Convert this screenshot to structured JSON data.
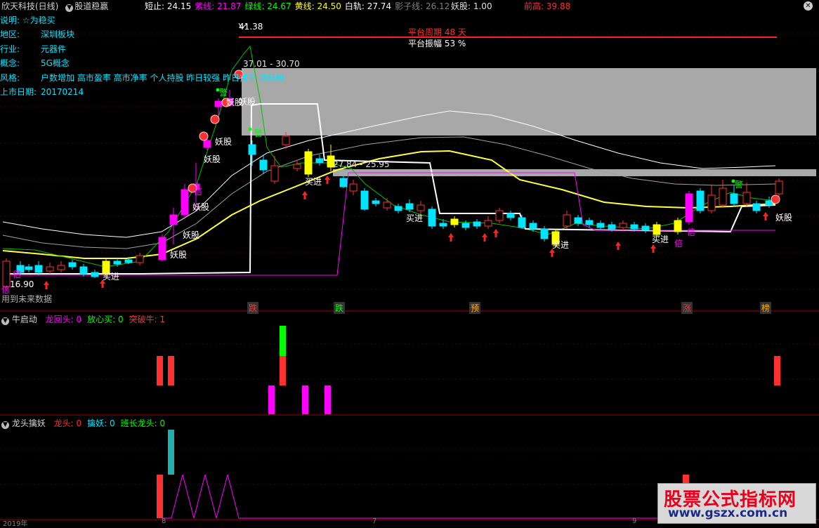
{
  "header": {
    "stock": "欣天科技(日线)",
    "indicator": "股道稳赢",
    "items": [
      {
        "label": "短止:",
        "value": "24.15",
        "color": "#ffffff"
      },
      {
        "label": "紫线:",
        "value": "21.87",
        "color": "#ff00ff"
      },
      {
        "label": "绿线:",
        "value": "24.67",
        "color": "#00ff00"
      },
      {
        "label": "黄线:",
        "value": "24.50",
        "color": "#ffff00"
      },
      {
        "label": "白轨:",
        "value": "27.74",
        "color": "#ffffff"
      },
      {
        "label": "影子线:",
        "value": "26.12",
        "color": "#808080"
      }
    ],
    "yaogu": "妖股: 1.00",
    "qiangao": "前高: 39.88"
  },
  "info": {
    "desc": "说明: ☆为稳买",
    "rows": [
      {
        "key": "地区:",
        "val": "深圳板块"
      },
      {
        "key": "行业:",
        "val": "元器件"
      },
      {
        "key": "概念:",
        "val": "5G概念"
      },
      {
        "key": "风格:",
        "val": "户数增加 高市盈率 高市净率 个人持股 昨日较强 昨日换手 活跃股"
      },
      {
        "key": "上市日期:",
        "val": "20170214"
      }
    ]
  },
  "annotations": {
    "peak_price": "41.38",
    "low_price": "16.90",
    "zone1": "37.01 - 30.70",
    "zone2": "27.84 - 25.95",
    "platform_period": "平台周期 48 天",
    "platform_amplitude": "平台振幅 53 %",
    "future_data": "用到未来数据",
    "markers": [
      "跌",
      "跌",
      "预",
      "涨",
      "榜"
    ],
    "buy": "买进",
    "demon": "妖股",
    "warn": "警",
    "double": "倍"
  },
  "panel2": {
    "name": "牛启动",
    "items": [
      {
        "label": "龙回头:",
        "value": "0",
        "color": "#ff00ff"
      },
      {
        "label": "放心买:",
        "value": "0",
        "color": "#00ff00"
      },
      {
        "label": "突破牛:",
        "value": "1",
        "color": "#ff3030"
      }
    ]
  },
  "panel3": {
    "name": "龙头擒妖",
    "items": [
      {
        "label": "龙头:",
        "value": "0",
        "color": "#ff3030"
      },
      {
        "label": "擒妖:",
        "value": "0",
        "color": "#00e5ff"
      },
      {
        "label": "班长龙头:",
        "value": "0",
        "color": "#00ff00"
      }
    ]
  },
  "axis_dates": [
    "2019年",
    "8",
    "7",
    "9"
  ],
  "logo": {
    "main": "股票公式指标网",
    "url": "www.gszx.com.cn"
  },
  "colors": {
    "up": "#ff3030",
    "down": "#00e5ff",
    "yellow": "#ffff00",
    "white": "#ffffff",
    "magenta": "#ff00ff",
    "green": "#00ff00",
    "gray": "#a0a0a0"
  }
}
